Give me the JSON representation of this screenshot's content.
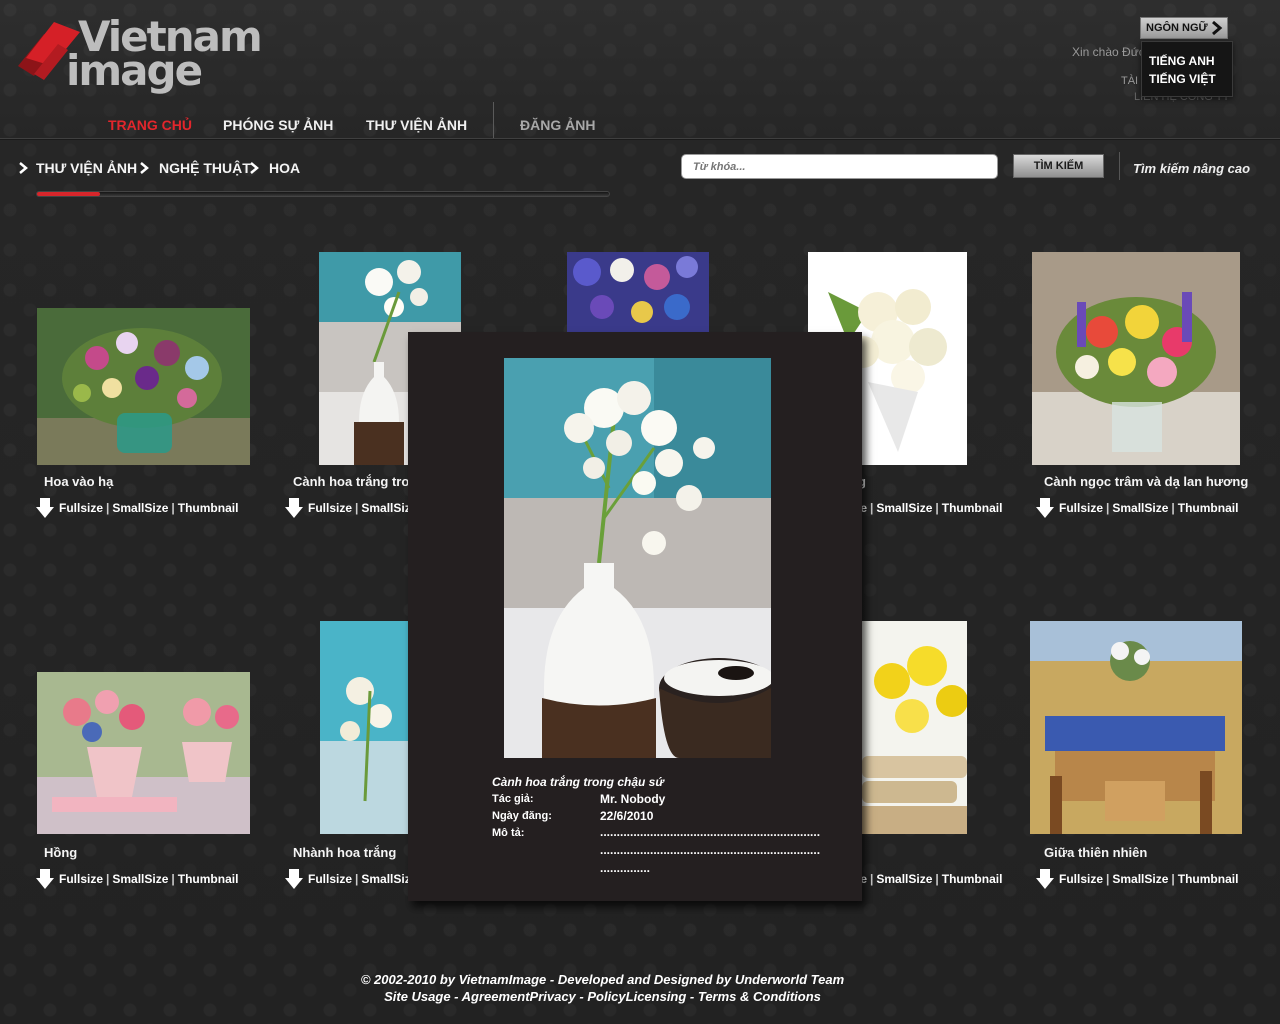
{
  "logo": {
    "line1": "Vietnam",
    "line2": "image"
  },
  "topbar": {
    "language_button": "NGÔN NGỮ",
    "language_options": [
      "TIẾNG ANH",
      "TIẾNG VIỆT"
    ],
    "greeting": "Xin chào Đức Tiếp đăng xuất",
    "account_link": "TÀI",
    "contact_link": "LIÊN HỆ CÔNG TY"
  },
  "nav": {
    "items": [
      "TRANG CHỦ",
      "PHÓNG SỰ ẢNH",
      "THƯ VIỆN ẢNH"
    ],
    "upload": "ĐĂNG ẢNH"
  },
  "breadcrumb": [
    "THƯ VIỆN ẢNH",
    "NGHỆ THUẬT",
    "HOA"
  ],
  "progress": {
    "value_percent": 11
  },
  "search": {
    "placeholder": "Từ khóa...",
    "button": "TÌM KIẾM",
    "advanced": "Tìm kiếm nâng cao"
  },
  "gallery": {
    "link_full": "Fullsize",
    "link_small": "SmallSize",
    "link_thumb": "Thumbnail",
    "items": [
      {
        "title": "Hoa vào hạ"
      },
      {
        "title": "Cành hoa trắng tro"
      },
      {
        "title": ""
      },
      {
        "title": "g"
      },
      {
        "title": "Cành ngọc trâm và dạ lan hương"
      },
      {
        "title": "Hồng"
      },
      {
        "title": "Nhành hoa trắng"
      },
      {
        "title": ""
      },
      {
        "title": ""
      },
      {
        "title": "Giữa thiên nhiên"
      }
    ]
  },
  "popup": {
    "title": "Cành hoa trắng trong chậu sứ",
    "author_label": "Tác giả:",
    "author": "Mr. Nobody",
    "date_label": "Ngày đăng:",
    "date": "22/6/2010",
    "desc_label": "Mô tả:",
    "desc_line1": "..................................................................",
    "desc_line2": "..................................................................",
    "desc_line3": "..............."
  },
  "footer": {
    "line1": "© 2002-2010 by VietnamImage - Developed and Designed by Underworld Team",
    "line2": "Site Usage - AgreementPrivacy  - PolicyLicensing - Terms & Conditions"
  },
  "colors": {
    "accent": "#e3262c",
    "background": "#262626",
    "popup": "#241f20"
  }
}
